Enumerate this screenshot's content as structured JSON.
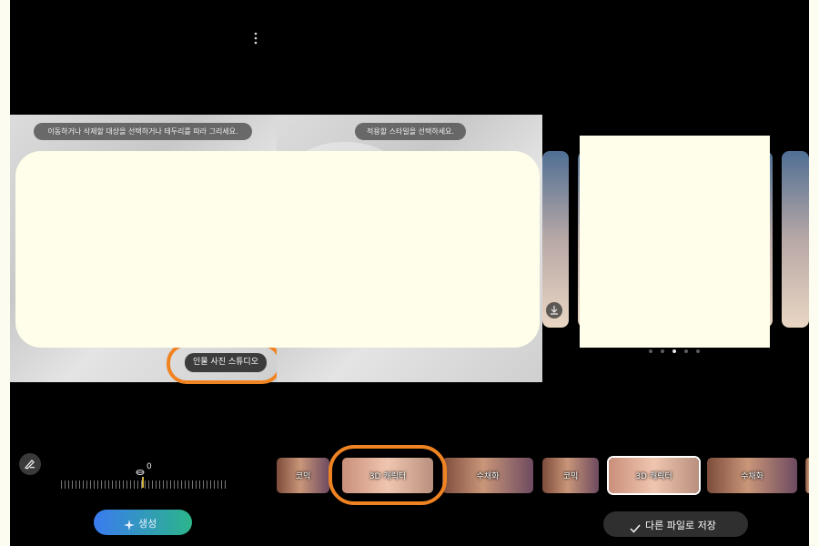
{
  "panel1": {
    "hint": "이동하거나 삭제할 대상을 선택하거나 테두리를 따라 그리세요.",
    "style_chip": "인물 사진 스튜디오",
    "rotation_value": "0",
    "generate_label": "생성",
    "icons": [
      "more-vert-icon",
      "brush-icon",
      "rotate-icon",
      "sparkle-icon"
    ]
  },
  "panel2": {
    "hint": "적용할 스타일을 선택하세요.",
    "styles": [
      "코믹",
      "3D 캐릭터",
      "수채화"
    ]
  },
  "panel3": {
    "styles": [
      "코믹",
      "3D 캐릭터",
      "수채화"
    ],
    "selected_style": "3D 캐릭터",
    "page_count": 5,
    "active_page": 3,
    "save_label": "다른 파일로 저장",
    "icons": [
      "download-icon",
      "check-icon"
    ]
  },
  "colors": {
    "highlight_ring": "#f08321",
    "generate_gradient": [
      "#3a7bf0",
      "#2bb58a"
    ],
    "redacted_fill": "#fffeea"
  }
}
